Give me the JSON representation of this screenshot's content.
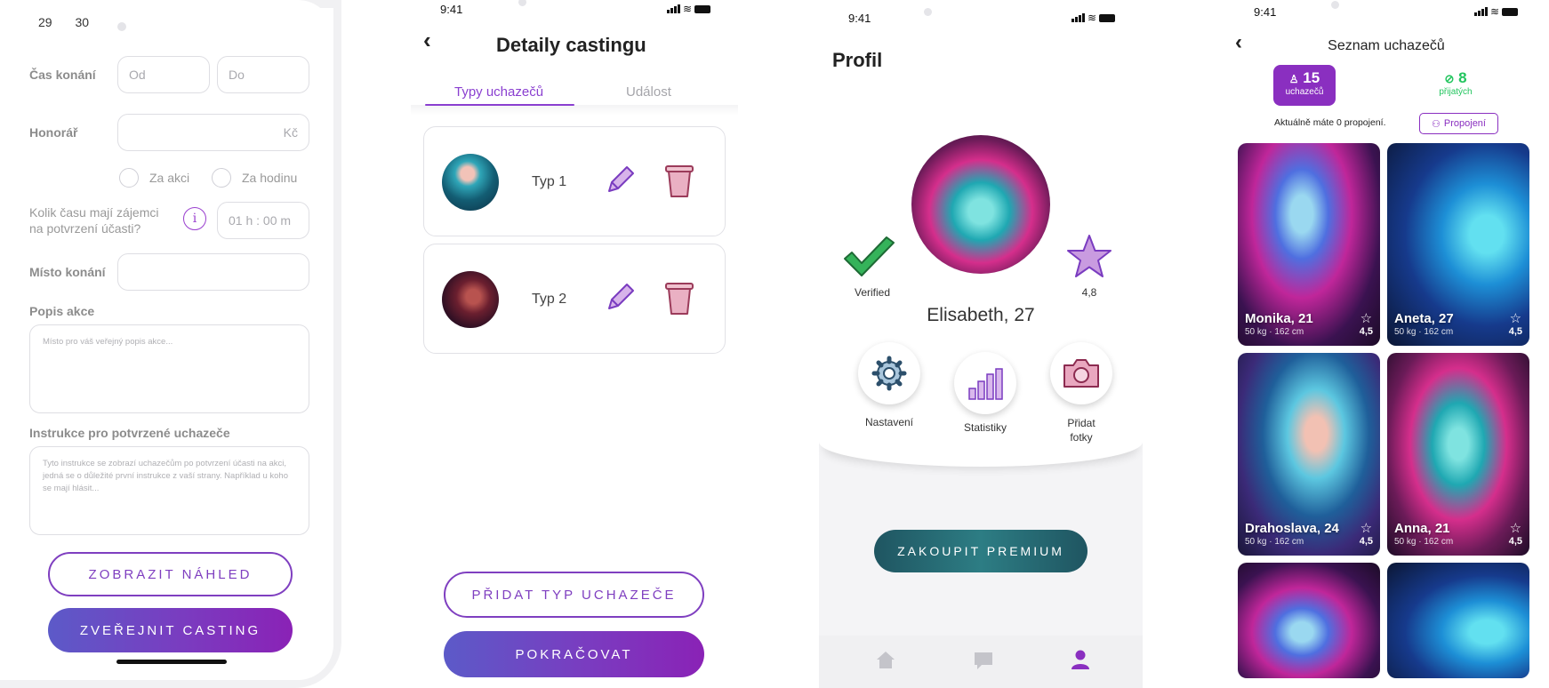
{
  "colors": {
    "accent": "#7f3fc0",
    "teal": "#2d7d84",
    "green": "#22c55e",
    "pink": "#d878a5"
  },
  "form": {
    "day_29": "29",
    "day_30": "30",
    "time_label": "Čas konání",
    "time_from_placeholder": "Od",
    "time_to_placeholder": "Do",
    "fee_label": "Honorář",
    "fee_currency": "Kč",
    "per_event_label": "Za akci",
    "per_hour_label": "Za hodinu",
    "confirm_time_label_1": "Kolik času mají zájemci",
    "confirm_time_label_2": "na potvrzení účasti?",
    "info_icon": "i",
    "confirm_time_value": "01 h : 00 m",
    "place_label": "Místo konání",
    "description_label": "Popis akce",
    "description_placeholder": "Místo pro váš veřejný popis akce...",
    "instructions_label": "Instrukce pro potvrzené uchazeče",
    "instructions_placeholder": "Tyto instrukce se zobrazí uchazečům po potvrzení účasti na akci, jedná se o důležité první instrukce z vaší strany. Například u koho se mají hlásit...",
    "preview_button": "ZOBRAZIT NÁHLED",
    "publish_button": "ZVEŘEJNIT CASTING"
  },
  "details": {
    "time": "9:41",
    "back": "‹",
    "title": "Detaily castingu",
    "tab_types": "Typy uchazečů",
    "tab_event": "Událost",
    "types": [
      {
        "label": "Typ 1"
      },
      {
        "label": "Typ 2"
      }
    ],
    "add_type_button": "PŘIDAT TYP UCHAZEČE",
    "continue_button": "POKRAČOVAT"
  },
  "profile": {
    "time": "9:41",
    "title": "Profil",
    "verified_label": "Verified",
    "rating": "4,8",
    "name": "Elisabeth, 27",
    "settings_label": "Nastavení",
    "stats_label": "Statistiky",
    "add_photos_label_1": "Přidat",
    "add_photos_label_2": "fotky",
    "premium_button": "ZAKOUPIT PREMIUM",
    "nav": [
      "home-icon",
      "chat-icon",
      "profile-icon"
    ]
  },
  "applicants": {
    "time": "9:41",
    "back": "‹",
    "title": "Seznam uchazečů",
    "applicants_count": "15",
    "applicants_label": "uchazečů",
    "accepted_count": "8",
    "accepted_label": "přijatých",
    "connections_text": "Aktuálně máte 0 propojení.",
    "connections_button": "Propojení",
    "cards": [
      {
        "name": "Monika, 21",
        "stats": "50 kg · 162 cm",
        "rating": "4,5"
      },
      {
        "name": "Aneta, 27",
        "stats": "50 kg · 162 cm",
        "rating": "4,5"
      },
      {
        "name": "Drahoslava, 24",
        "stats": "50 kg · 162 cm",
        "rating": "4,5"
      },
      {
        "name": "Anna, 21",
        "stats": "50 kg · 162 cm",
        "rating": "4,5"
      }
    ]
  }
}
